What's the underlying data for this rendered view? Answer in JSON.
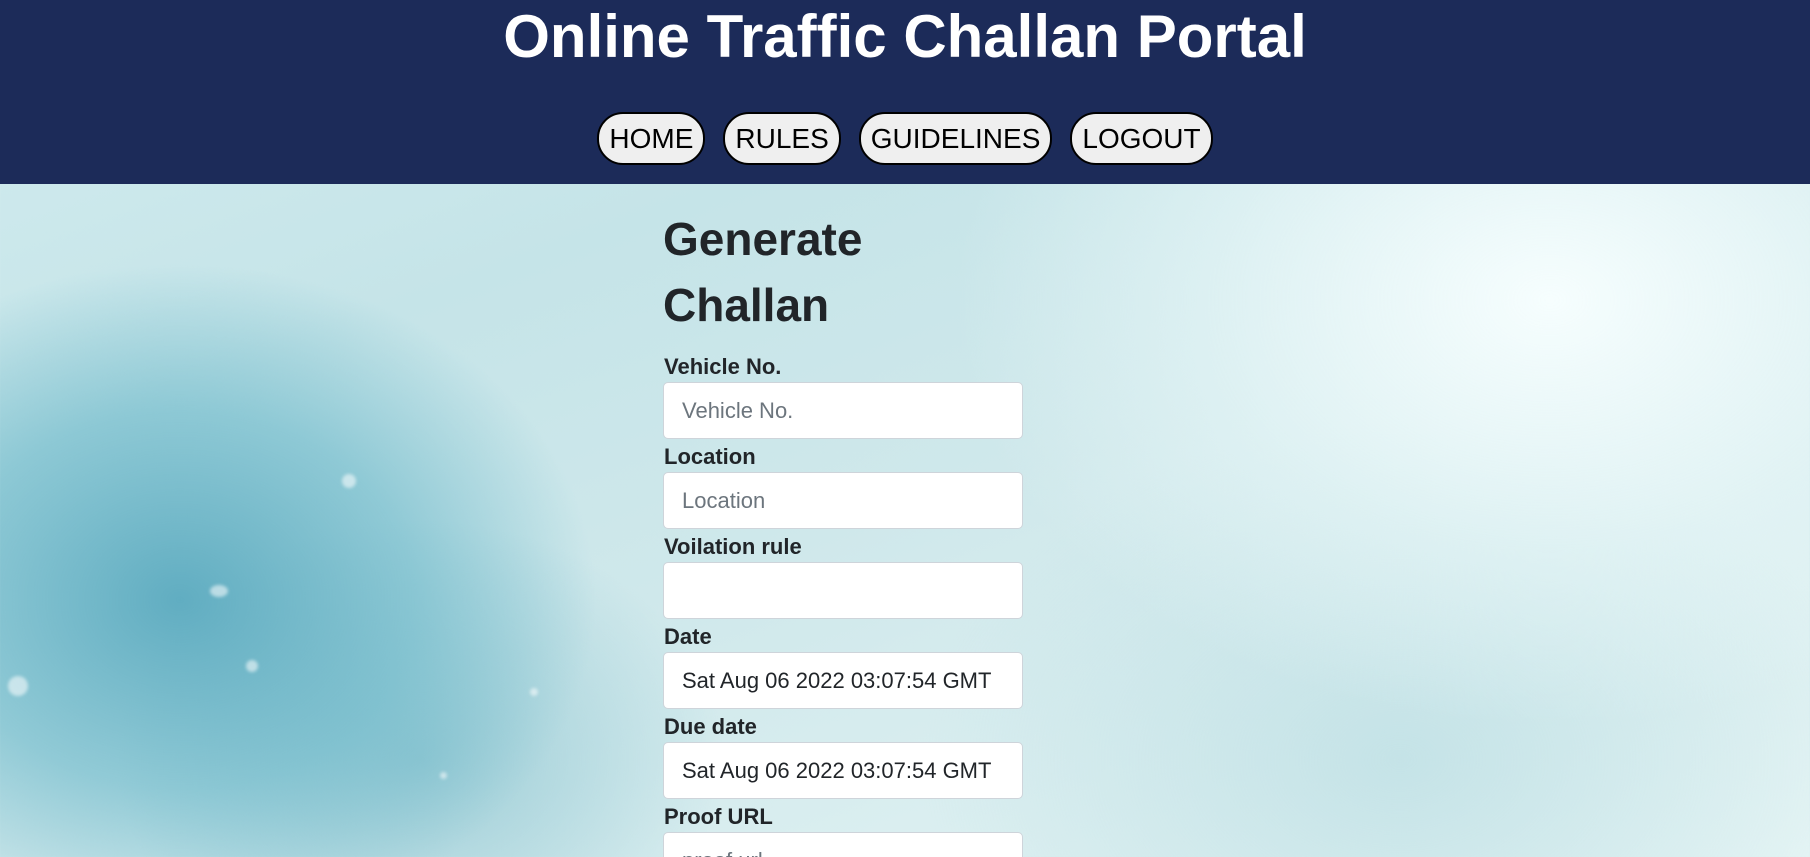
{
  "header": {
    "title": "Online Traffic Challan Portal"
  },
  "nav": {
    "items": [
      {
        "label": "HOME"
      },
      {
        "label": "RULES"
      },
      {
        "label": "GUIDELINES"
      },
      {
        "label": "LOGOUT"
      }
    ]
  },
  "form": {
    "title": "Generate Challan",
    "vehicle": {
      "label": "Vehicle No.",
      "placeholder": "Vehicle No.",
      "value": ""
    },
    "location": {
      "label": "Location",
      "placeholder": "Location",
      "value": ""
    },
    "violation": {
      "label": "Voilation rule",
      "value": ""
    },
    "date": {
      "label": "Date",
      "value": "Sat Aug 06 2022 03:07:54 GMT"
    },
    "due_date": {
      "label": "Due date",
      "value": "Sat Aug 06 2022 03:07:54 GMT"
    },
    "proof": {
      "label": "Proof URL",
      "placeholder": "proof url",
      "value": ""
    }
  },
  "colors": {
    "header_bg": "#1c2b59",
    "header_text": "#ffffff",
    "nav_button_bg": "#efefef",
    "text": "#212529",
    "placeholder": "#6c757d"
  }
}
